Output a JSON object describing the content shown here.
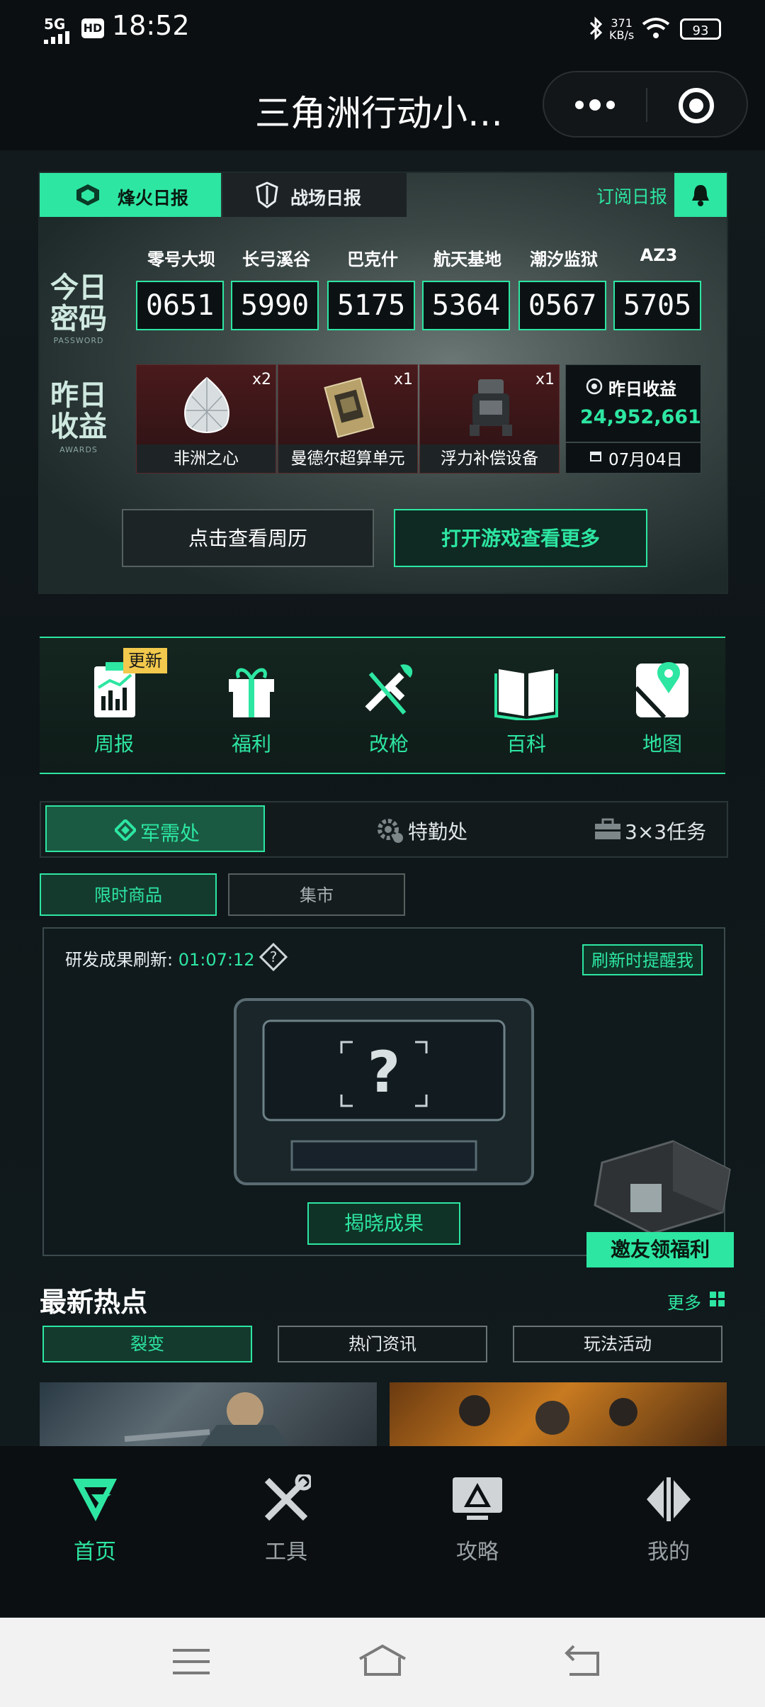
{
  "status_bar": {
    "network": "5G",
    "hd": "HD",
    "time": "18:52",
    "speed_value": "371",
    "speed_unit": "KB/s",
    "battery": "93"
  },
  "title_bar": {
    "title": "三角洲行动小…"
  },
  "report": {
    "tabs": [
      "烽火日报",
      "战场日报"
    ],
    "subscribe": "订阅日报",
    "password_title": "今日\n密码",
    "password_sub": "PASSWORD",
    "maps": [
      {
        "name": "零号大坝",
        "code": "0651"
      },
      {
        "name": "长弓溪谷",
        "code": "5990"
      },
      {
        "name": "巴克什",
        "code": "5175"
      },
      {
        "name": "航天基地",
        "code": "5364"
      },
      {
        "name": "潮汐监狱",
        "code": "0567"
      },
      {
        "name": "AZ3",
        "code": "5705"
      }
    ],
    "awards_title": "昨日\n收益",
    "awards_sub": "AWARDS",
    "awards": [
      {
        "name": "非洲之心",
        "count": "x2"
      },
      {
        "name": "曼德尔超算单元",
        "count": "x1"
      },
      {
        "name": "浮力补偿设备",
        "count": "x1"
      }
    ],
    "income_label": "昨日收益",
    "income_value": "24,952,661",
    "income_date": "07月04日",
    "btn_week": "点击查看周历",
    "btn_open": "打开游戏查看更多"
  },
  "tools": {
    "badge": "更新",
    "items": [
      {
        "label": "周报",
        "icon": "weekly-report-icon"
      },
      {
        "label": "福利",
        "icon": "gift-icon"
      },
      {
        "label": "改枪",
        "icon": "gun-wrench-icon"
      },
      {
        "label": "百科",
        "icon": "book-icon"
      },
      {
        "label": "地图",
        "icon": "map-pin-icon"
      }
    ]
  },
  "segments": [
    "军需处",
    "特勤处",
    "3×3任务"
  ],
  "chips": [
    "限时商品",
    "集市"
  ],
  "research": {
    "refresh_label": "研发成果刷新:",
    "refresh_time": "01:07:12",
    "remind": "刷新时提醒我",
    "reveal": "揭晓成果",
    "invite": "邀友领福利"
  },
  "hot": {
    "title": "最新热点",
    "more": "更多",
    "tabs": [
      "裂变",
      "热门资讯",
      "玩法活动"
    ]
  },
  "bottom_nav": [
    "首页",
    "工具",
    "攻略",
    "我的"
  ],
  "colors": {
    "accent": "#2de6a2",
    "background": "#0f1518"
  }
}
